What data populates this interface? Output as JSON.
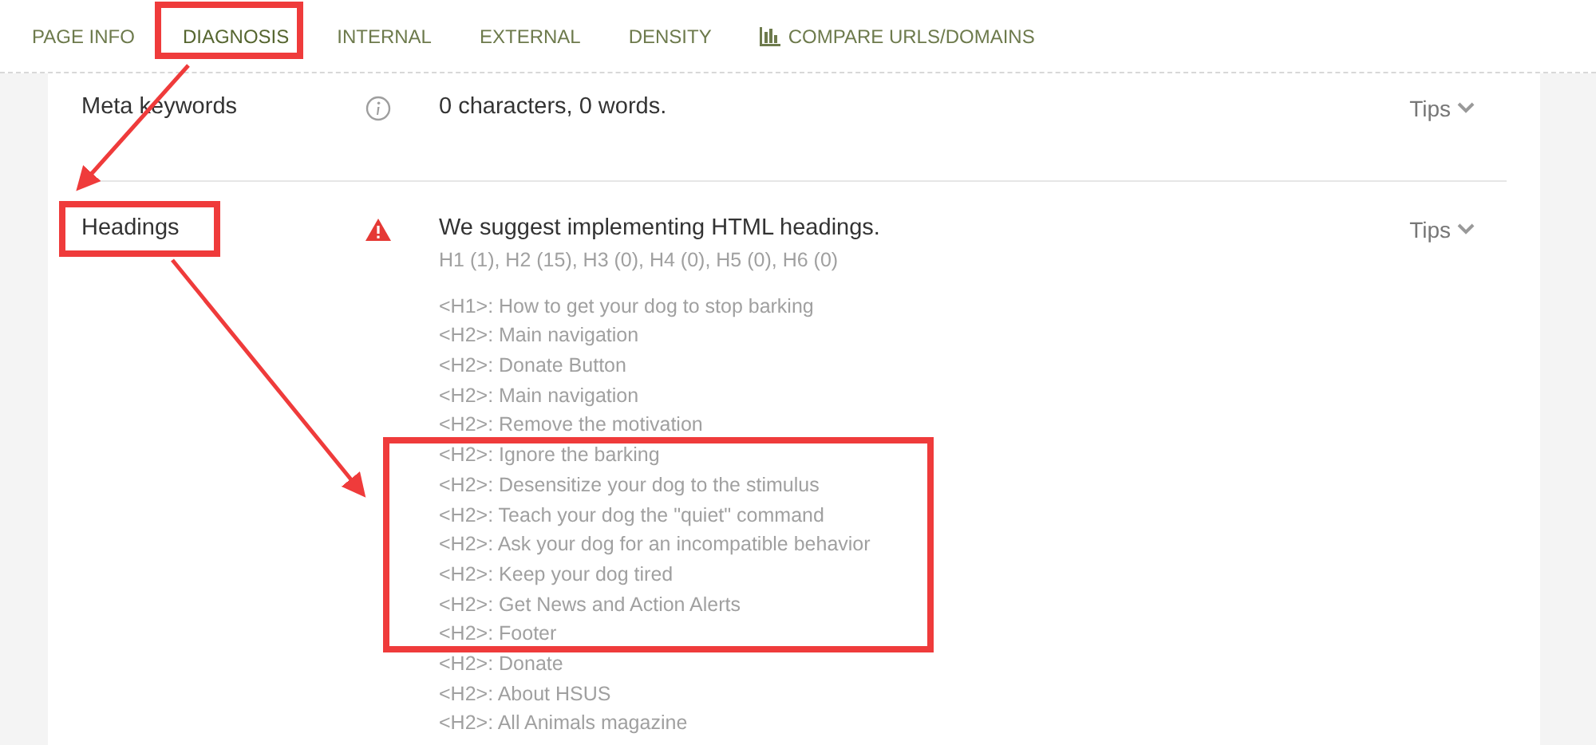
{
  "tabs": [
    {
      "label": "PAGE INFO",
      "selected": false,
      "kind": "tab"
    },
    {
      "label": "DIAGNOSIS",
      "selected": true,
      "kind": "tab"
    },
    {
      "label": "INTERNAL",
      "selected": false,
      "kind": "tab"
    },
    {
      "label": "EXTERNAL",
      "selected": false,
      "kind": "tab"
    },
    {
      "label": "DENSITY",
      "selected": false,
      "kind": "tab"
    },
    {
      "label": "COMPARE URLS/DOMAINS",
      "selected": false,
      "kind": "tool"
    }
  ],
  "rows": [
    {
      "label": "Meta keywords",
      "kind": "info",
      "message": "0 characters, 0 words.",
      "tips": "Tips"
    },
    {
      "label": "Headings",
      "kind": "warning",
      "message": "We suggest implementing HTML headings.",
      "summary": "H1 (1), H2 (15), H3 (0), H4 (0), H5 (0), H6 (0)",
      "tips": "Tips",
      "headings": [
        "<H1>: How to get your dog to stop barking",
        "<H2>: Main navigation",
        "<H2>: Donate Button",
        "<H2>: Main navigation",
        "<H2>: Remove the motivation",
        "<H2>: Ignore the barking",
        "<H2>: Desensitize your dog to the stimulus",
        "<H2>: Teach your dog the \"quiet\" command",
        "<H2>: Ask your dog for an incompatible behavior",
        "<H2>: Keep your dog tired",
        "<H2>: Get News and Action Alerts",
        "<H2>: Footer",
        "<H2>: Donate",
        "<H2>: About HSUS",
        "<H2>: All Animals magazine"
      ]
    }
  ]
}
